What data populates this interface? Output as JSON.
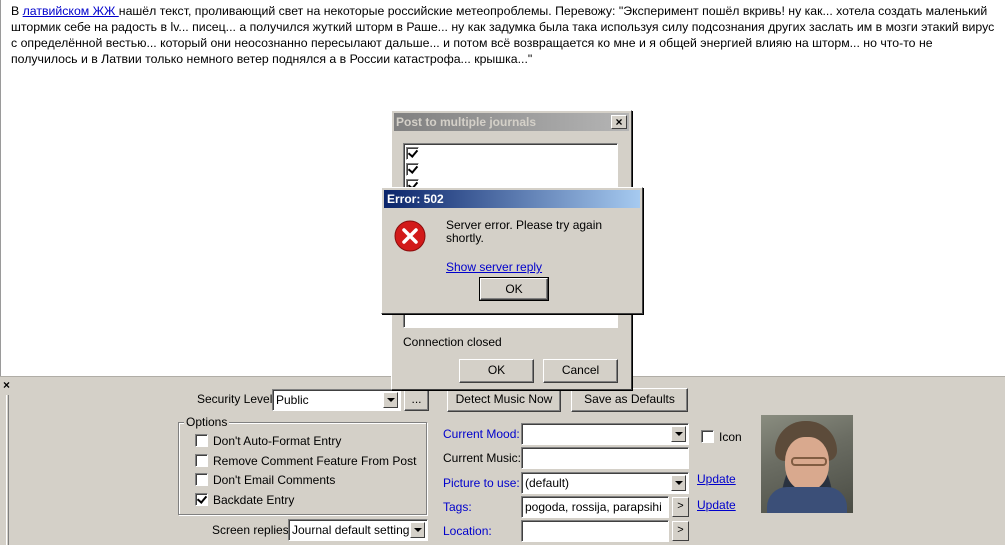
{
  "editor": {
    "text_before_link": "В ",
    "link_text": "латвийском ЖЖ ",
    "text_after_link": "нашёл текст, проливающий свет на некоторые российские метеопроблемы. Перевожу: \"Эксперимент пошёл вкривь! ну как... хотела создать маленький штормик себе на радость в lv... писец... а получился жуткий шторм в Раше... ну как задумка была така используя силу подсознания других заслать им в мозги этакий вирус с определённой вестью... который они неосознанно пересылают дальше... и потом всё возвращается ко мне и я общей энергией влияю на шторм... но что-то не получилось и в Латвии только немного ветер поднялся а в России катастрофа... крышка...\""
  },
  "panel": {
    "close_glyph": "×",
    "security_label": "Security Level:",
    "security_value": "Public",
    "security_more_button": "...",
    "detect_music_button": "Detect Music Now",
    "save_defaults_button": "Save as Defaults",
    "options_title": "Options",
    "options": [
      {
        "label": "Don't Auto-Format Entry",
        "checked": false
      },
      {
        "label": "Remove Comment Feature From Post",
        "checked": false
      },
      {
        "label": "Don't Email Comments",
        "checked": false
      },
      {
        "label": "Backdate Entry",
        "checked": true
      }
    ],
    "screen_replies_label": "Screen replies:",
    "screen_replies_value": "Journal default setting",
    "current_mood_label": "Current Mood:",
    "current_mood_value": "",
    "current_music_label": "Current Music:",
    "current_music_value": "",
    "picture_label": "Picture to use:",
    "picture_value": "(default)",
    "tags_label": "Tags:",
    "tags_value": "pogoda, rossija, parapsihi",
    "location_label": "Location:",
    "location_value": "",
    "icon_checkbox_label": "Icon",
    "update_link_1": "Update",
    "update_link_2": "Update",
    "arrow_glyph": ">"
  },
  "post_dialog": {
    "title": "Post to multiple journals",
    "close_glyph": "×",
    "status": "Connection closed",
    "ok_button": "OK",
    "cancel_button": "Cancel"
  },
  "error_dialog": {
    "title": "Error: 502",
    "message": "Server error.  Please try again shortly.",
    "show_reply_link": "Show server reply",
    "ok_button": "OK"
  },
  "colors": {
    "dialog_bg": "#d4d0c8",
    "active_title_start": "#0a246a",
    "active_title_end": "#a6caf0",
    "inactive_title": "#808080",
    "link": "#0000cc",
    "error_icon": "#d21a1a"
  }
}
